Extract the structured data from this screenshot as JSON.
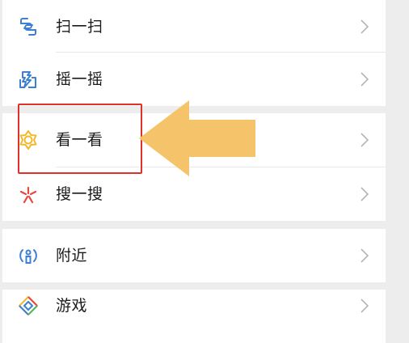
{
  "menu": {
    "items": [
      {
        "label": "扫一扫",
        "icon": "scan-icon"
      },
      {
        "label": "摇一摇",
        "icon": "shake-icon"
      },
      {
        "label": "看一看",
        "icon": "top-stories-icon"
      },
      {
        "label": "搜一搜",
        "icon": "search-sparkle-icon"
      },
      {
        "label": "附近",
        "icon": "nearby-icon"
      },
      {
        "label": "游戏",
        "icon": "games-icon"
      }
    ]
  },
  "colors": {
    "background": "#ededed",
    "row": "#ffffff",
    "scan_icon": "#3d7fd0",
    "top_stories_icon": "#f2b92d",
    "search_icon": "#e8473d",
    "highlight_box": "#e0302a",
    "pointer_arrow": "#f5c46a"
  },
  "annotations": {
    "highlight_target": "看一看",
    "pointer": "arrow-left"
  }
}
